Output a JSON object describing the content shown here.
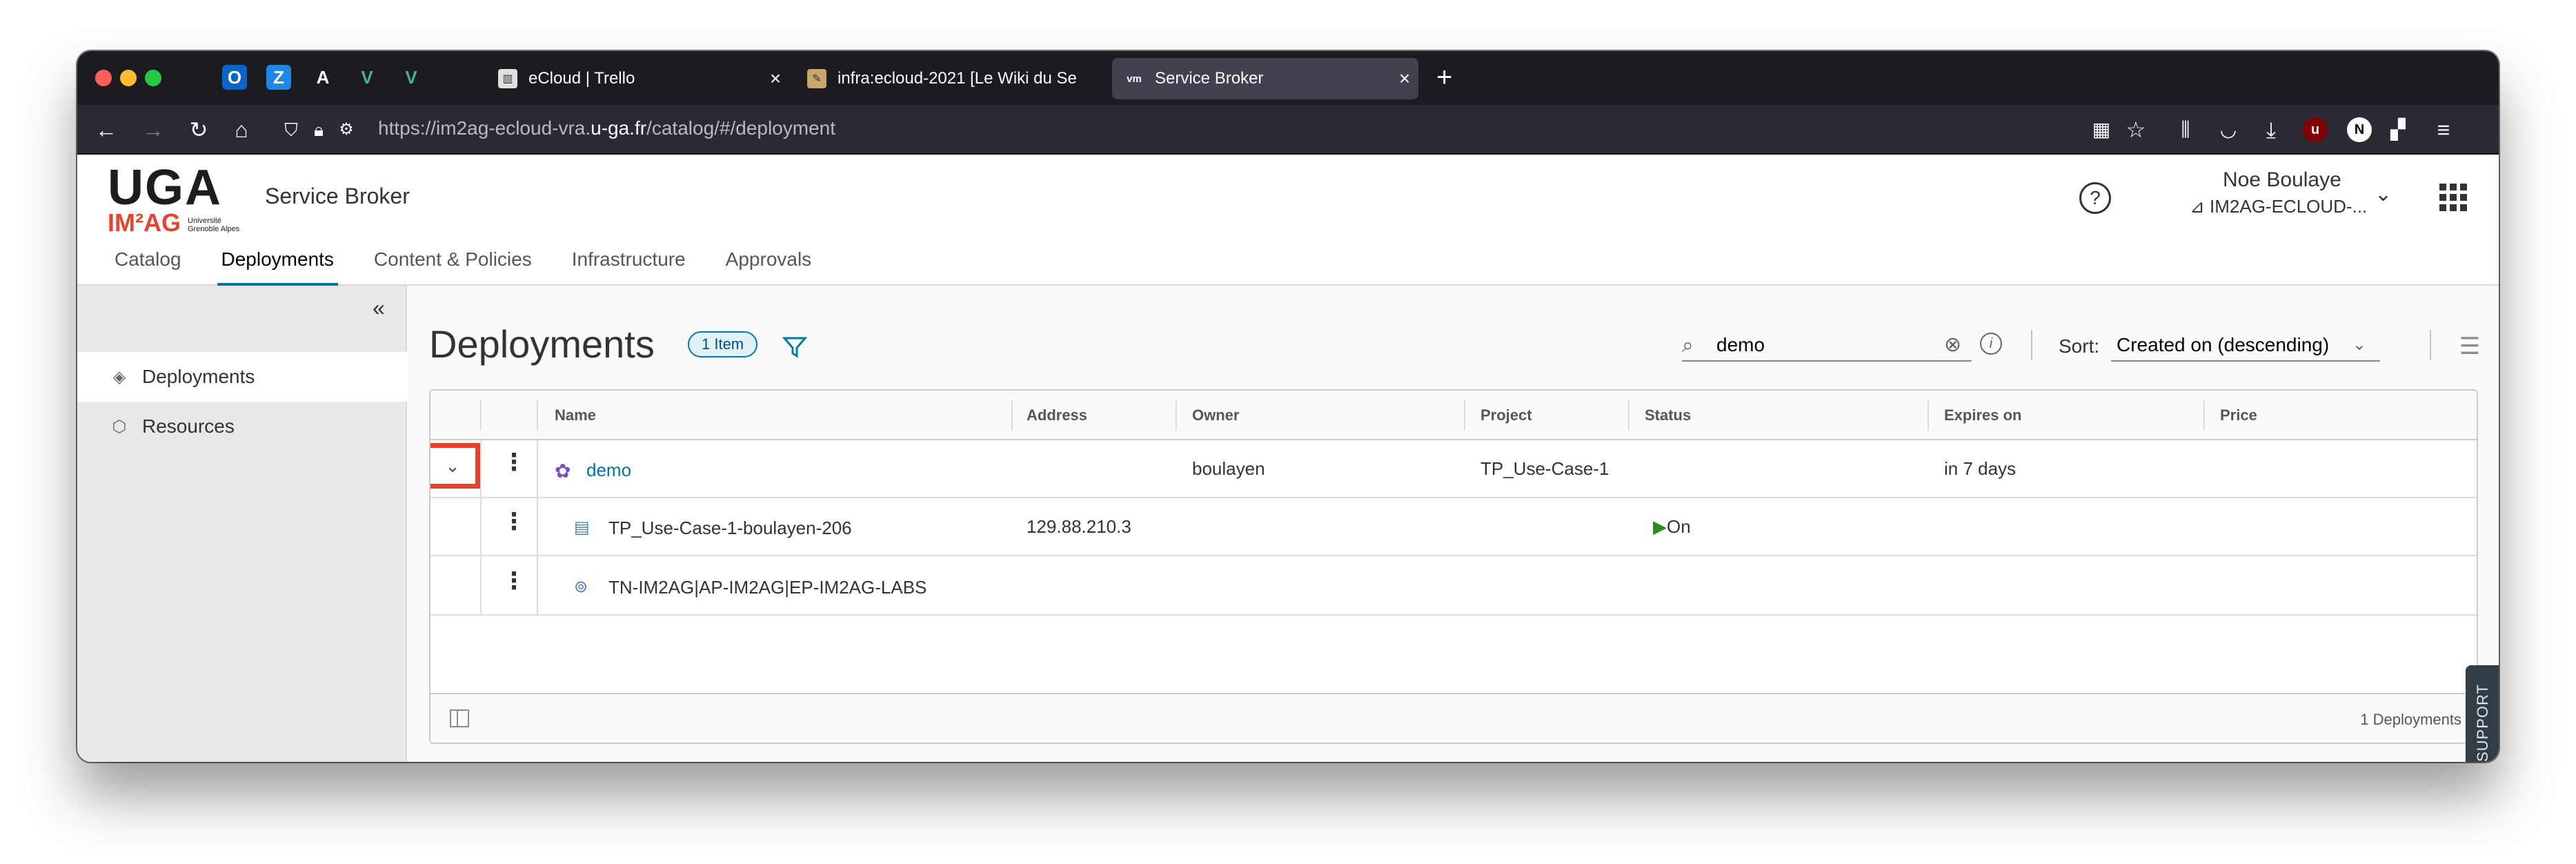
{
  "browser": {
    "pinned_tabs": [
      {
        "icon": "outlook-icon",
        "label": "O",
        "color": "#0a64c8"
      },
      {
        "icon": "zoho-icon",
        "label": "Z",
        "color": "#1e88e5"
      },
      {
        "icon": "adobe-icon",
        "label": "A",
        "color": "#ffffff"
      },
      {
        "icon": "vue-icon",
        "label": "V",
        "color": "#3fb984"
      },
      {
        "icon": "vue-icon",
        "label": "V",
        "color": "#3fb984"
      }
    ],
    "tabs": [
      {
        "title": "eCloud | Trello",
        "active": false
      },
      {
        "title": "infra:ecloud-2021 [Le Wiki du Se",
        "active": false
      },
      {
        "title": "Service Broker",
        "active": true
      }
    ],
    "url_prefix": "https://im2ag-ecloud-vra.",
    "url_host": "u-ga.fr",
    "url_suffix": "/catalog/#/deployment",
    "new_tab": "+",
    "close_glyph": "×"
  },
  "header": {
    "logo_main": "UGA",
    "logo_sub": "IM²AG",
    "logo_univ": "Université Grenoble Alpes",
    "app_name": "Service Broker",
    "help": "?",
    "user_name": "Noe Boulaye",
    "org_name": "IM2AG-ECLOUD-...",
    "tabs": [
      "Catalog",
      "Deployments",
      "Content & Policies",
      "Infrastructure",
      "Approvals"
    ]
  },
  "sidebar": {
    "collapse_glyph": "«",
    "items": [
      {
        "label": "Deployments",
        "active": true
      },
      {
        "label": "Resources",
        "active": false
      }
    ]
  },
  "content": {
    "title": "Deployments",
    "count_badge": "1 Item",
    "search": {
      "value": "demo"
    },
    "sort_label": "Sort:",
    "sort_value": "Created on (descending)"
  },
  "grid": {
    "columns": [
      "Name",
      "Address",
      "Owner",
      "Project",
      "Status",
      "Expires on",
      "Price"
    ],
    "rows": [
      {
        "name": "demo",
        "address": "",
        "owner": "boulayen",
        "project": "TP_Use-Case-1",
        "status": "",
        "expires": "in 7 days"
      },
      {
        "name": "TP_Use-Case-1-boulayen-206",
        "address": "129.88.210.3",
        "owner": "",
        "project": "",
        "status": "On",
        "expires": ""
      },
      {
        "name": "TN-IM2AG|AP-IM2AG|EP-IM2AG-LABS",
        "address": "",
        "owner": "",
        "project": "",
        "status": "",
        "expires": ""
      }
    ],
    "footer_count": "1 Deployments"
  },
  "support": {
    "label": "SUPPORT"
  },
  "colors": {
    "accent": "#0072a3",
    "highlight": "#e8412b",
    "status_on": "#2e8a1e"
  }
}
